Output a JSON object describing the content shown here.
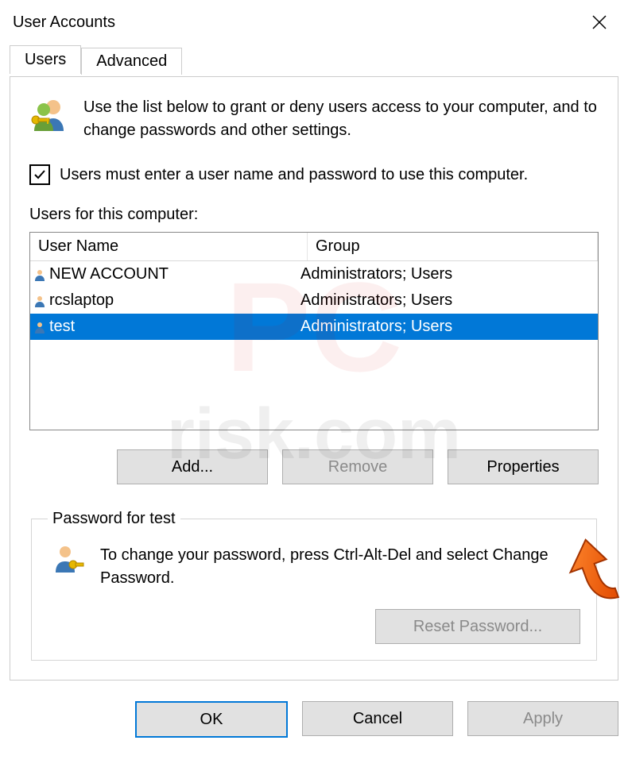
{
  "window": {
    "title": "User Accounts"
  },
  "tabs": {
    "users": "Users",
    "advanced": "Advanced",
    "active": "Users"
  },
  "intro": "Use the list below to grant or deny users access to your computer, and to change passwords and other settings.",
  "checkbox": {
    "label": "Users must enter a user name and password to use this computer.",
    "checked": true
  },
  "list": {
    "label": "Users for this computer:",
    "columns": {
      "name": "User Name",
      "group": "Group"
    },
    "rows": [
      {
        "name": "NEW ACCOUNT",
        "group": "Administrators; Users",
        "selected": false
      },
      {
        "name": "rcslaptop",
        "group": "Administrators; Users",
        "selected": false
      },
      {
        "name": "test",
        "group": "Administrators; Users",
        "selected": true
      }
    ]
  },
  "buttons": {
    "add": "Add...",
    "remove": "Remove",
    "properties": "Properties"
  },
  "password_group": {
    "legend": "Password for test",
    "text": "To change your password, press Ctrl-Alt-Del and select Change Password.",
    "reset": "Reset Password..."
  },
  "footer": {
    "ok": "OK",
    "cancel": "Cancel",
    "apply": "Apply"
  },
  "watermark": "PCrisk.com"
}
